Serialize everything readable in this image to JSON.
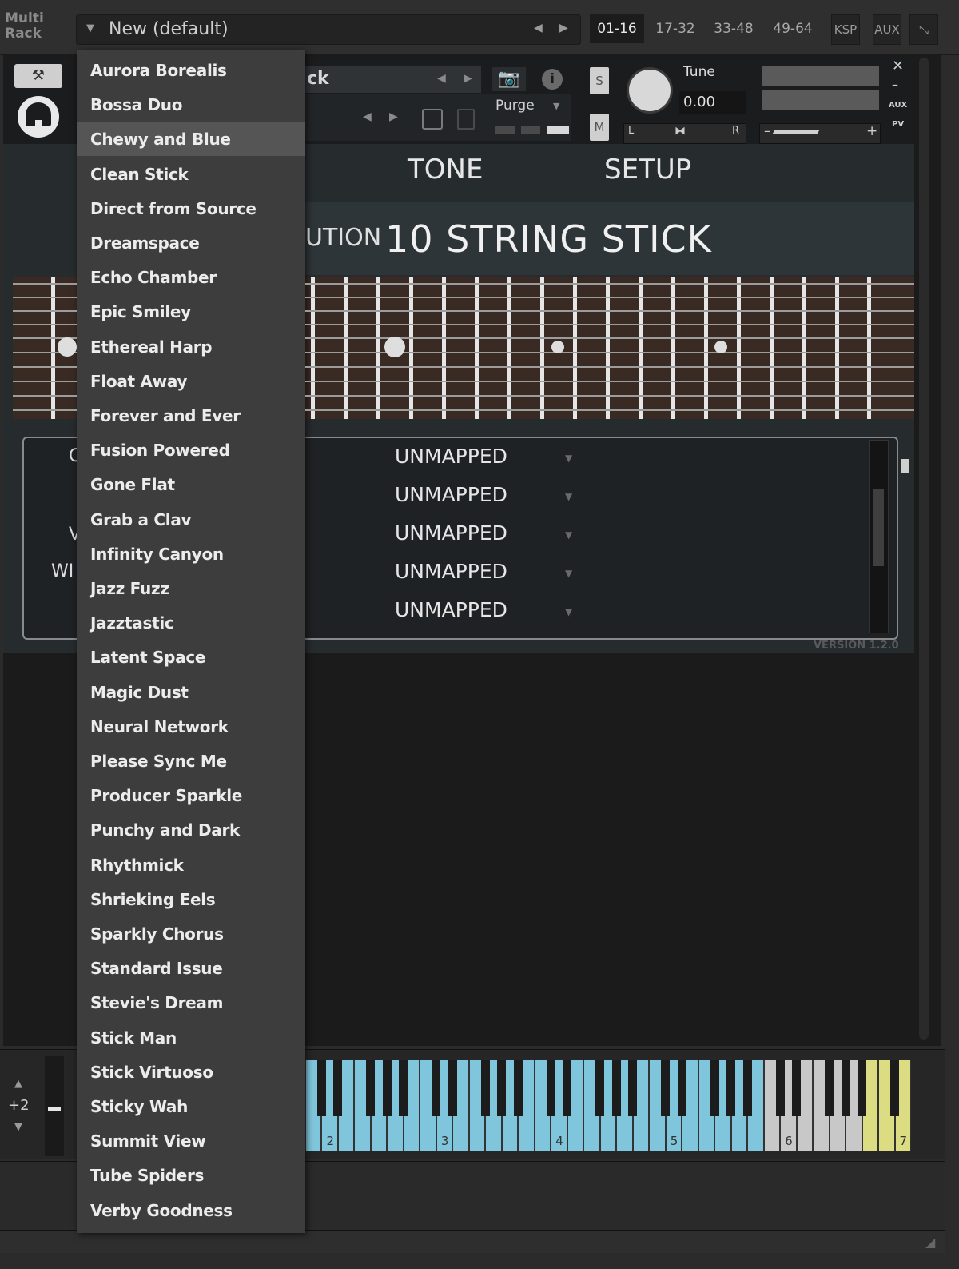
{
  "topbar": {
    "multirack_label": "Multi\nRack",
    "preset_name": "New (default)",
    "ranges": [
      "01-16",
      "17-32",
      "33-48",
      "49-64"
    ],
    "ksp_label": "KSP",
    "aux_label": "AUX",
    "collapse_icon": "collapse-arrows-icon"
  },
  "instrument": {
    "name_fragment": "ck",
    "purge_label": "Purge",
    "solo_label": "S",
    "mute_label": "M",
    "tune_label": "Tune",
    "tune_value": "0.00",
    "pan_left": "L",
    "pan_right": "R",
    "aux_label": "AUX",
    "pv_label": "PV",
    "tabs": [
      "TONE",
      "SETUP"
    ],
    "title_fragment": "UTION",
    "title": "10 STRING STICK",
    "mappings": [
      "UNMAPPED",
      "UNMAPPED",
      "UNMAPPED",
      "UNMAPPED",
      "UNMAPPED"
    ],
    "left_fragments": [
      "C",
      "V",
      "WI"
    ],
    "version": "VERSION 1.2.0"
  },
  "keyboard": {
    "octave_offset": "+2",
    "octave_labels": [
      "2",
      "3",
      "4",
      "5",
      "6",
      "7"
    ],
    "colors": {
      "mapped": "#7fc6dc",
      "neutral": "#c8c8c8",
      "keyswitch": "#dcdc82"
    }
  },
  "preset_menu": {
    "selected_index": 2,
    "items": [
      "Aurora Borealis",
      "Bossa Duo",
      "Chewy and Blue",
      "Clean Stick",
      "Direct from Source",
      "Dreamspace",
      "Echo Chamber",
      "Epic Smiley",
      "Ethereal Harp",
      "Float Away",
      "Forever and Ever",
      "Fusion Powered",
      "Gone Flat",
      "Grab a Clav",
      "Infinity Canyon",
      "Jazz Fuzz",
      "Jazztastic",
      "Latent Space",
      "Magic Dust",
      "Neural Network",
      "Please Sync Me",
      "Producer Sparkle",
      "Punchy and Dark",
      "Rhythmick",
      "Shrieking Eels",
      "Sparkly Chorus",
      "Standard Issue",
      "Stevie's Dream",
      "Stick Man",
      "Stick Virtuoso",
      "Sticky Wah",
      "Summit View",
      "Tube Spiders",
      "Verby Goodness"
    ]
  }
}
